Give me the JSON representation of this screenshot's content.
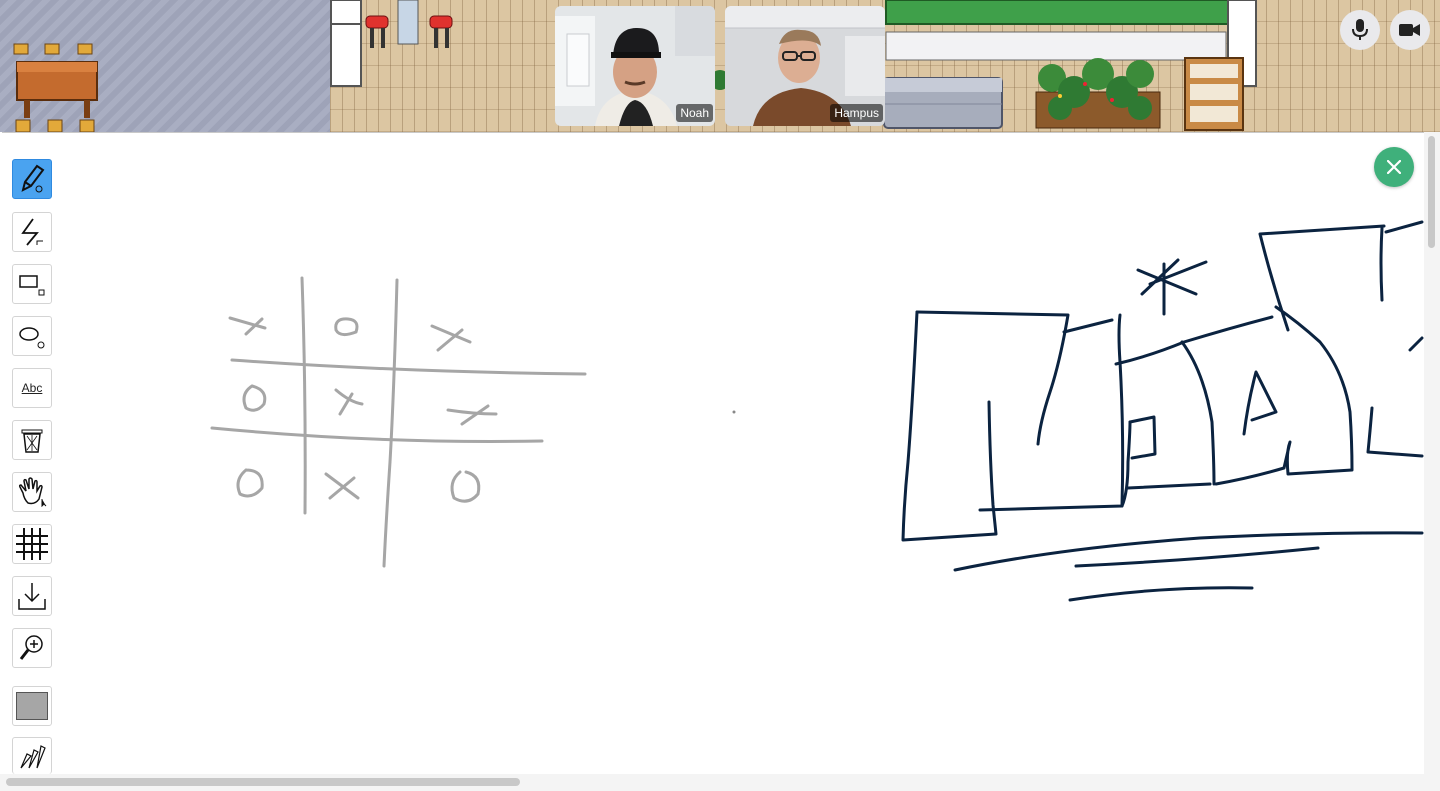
{
  "participants": [
    {
      "name": "Noah"
    },
    {
      "name": "Hampus"
    }
  ],
  "controls": {
    "mic_icon": "microphone-icon",
    "camera_icon": "video-camera-icon",
    "close_icon": "close-icon"
  },
  "toolbar": {
    "tools": [
      {
        "id": "pen",
        "icon": "pencil-icon",
        "active": true
      },
      {
        "id": "line",
        "icon": "line-icon"
      },
      {
        "id": "rectangle",
        "icon": "rectangle-icon"
      },
      {
        "id": "ellipse",
        "icon": "ellipse-icon"
      },
      {
        "id": "text",
        "label": "Abc"
      },
      {
        "id": "clear",
        "icon": "trash-icon"
      },
      {
        "id": "pan",
        "icon": "hand-icon"
      },
      {
        "id": "grid",
        "icon": "grid-icon"
      },
      {
        "id": "download",
        "icon": "download-icon"
      },
      {
        "id": "zoom",
        "icon": "zoom-in-icon"
      },
      {
        "id": "color",
        "icon": "color-swatch-icon",
        "value": "#a6a6a6"
      },
      {
        "id": "brushes",
        "icon": "brushes-icon"
      }
    ]
  },
  "colors": {
    "accent_close": "#3fb07b",
    "active_tool": "#4aa3f0",
    "stroke_gray": "#a6a6a6",
    "stroke_navy": "#0b2340"
  }
}
